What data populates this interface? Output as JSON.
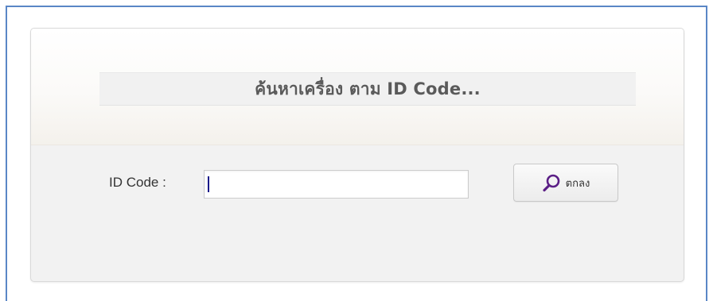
{
  "panel": {
    "title": "ค้นหาเครื่อง ตาม ID Code..."
  },
  "form": {
    "id_label": "ID Code :",
    "id_value": "",
    "submit_label": "ตกลง",
    "submit_icon": "search-icon",
    "icon_color": "#5b1f86"
  }
}
